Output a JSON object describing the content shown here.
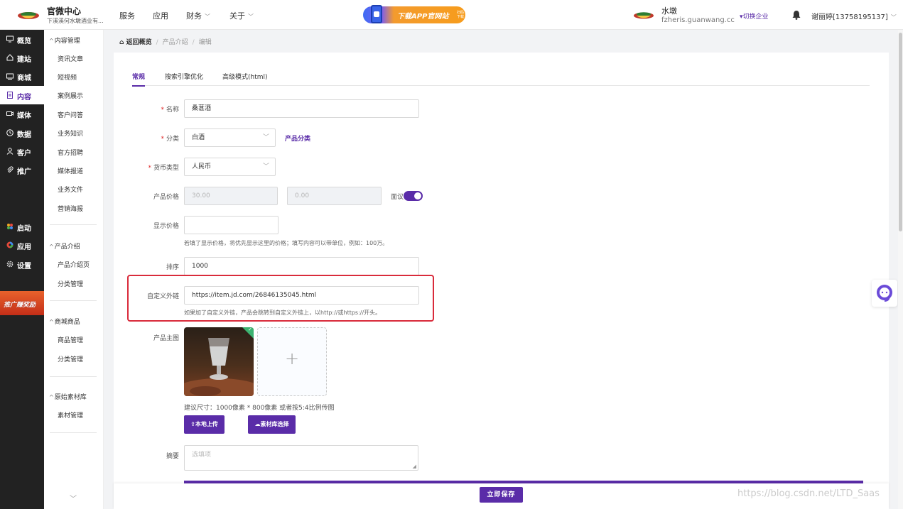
{
  "header": {
    "brand_name": "官微中心",
    "brand_sub": "下溪溪何水墩酒业有...",
    "nav": [
      {
        "label": "服务"
      },
      {
        "label": "应用"
      },
      {
        "label": "财务"
      },
      {
        "label": "关于"
      }
    ],
    "promo_text": "下载APP官网站",
    "promo_scan": "扫码下载",
    "site_name": "水墩",
    "site_domain": "fzheris.guanwang.cc",
    "switch_label": "切换企业",
    "user": "谢丽婷[13758195137]"
  },
  "sidebar_main": {
    "items": [
      {
        "label": "概览",
        "icon": "overview-icon"
      },
      {
        "label": "建站",
        "icon": "home-icon"
      },
      {
        "label": "商城",
        "icon": "shop-icon"
      },
      {
        "label": "内容",
        "icon": "document-icon",
        "active": true
      },
      {
        "label": "媒体",
        "icon": "video-icon"
      },
      {
        "label": "数据",
        "icon": "clock-icon"
      },
      {
        "label": "客户",
        "icon": "user-icon"
      },
      {
        "label": "推广",
        "icon": "paperclip-icon"
      },
      {
        "label": "启动",
        "icon": "flower-icon"
      },
      {
        "label": "应用",
        "icon": "apps-icon"
      },
      {
        "label": "设置",
        "icon": "gear-icon"
      }
    ],
    "reward_label": "推广赚奖励"
  },
  "sidebar_sub": {
    "groups": [
      {
        "title": "内容管理",
        "items": [
          "资讯文章",
          "短视频",
          "案例展示",
          "客户问答",
          "业务知识",
          "官方招聘",
          "媒体报道",
          "业务文件",
          "营销海报"
        ]
      },
      {
        "title": "产品介绍",
        "items": [
          "产品介绍页",
          "分类管理"
        ]
      },
      {
        "title": "商城商品",
        "items": [
          "商品管理",
          "分类管理"
        ]
      },
      {
        "title": "原始素材库",
        "items": [
          "素材管理"
        ]
      }
    ]
  },
  "breadcrumb": {
    "home": "返回概览",
    "level1": "产品介绍",
    "level2": "编辑"
  },
  "tabs": [
    "常规",
    "搜索引擎优化",
    "高级模式(html)"
  ],
  "form": {
    "name": {
      "label": "名称",
      "value": "桑葚酒"
    },
    "category": {
      "label": "分类",
      "value": "白酒",
      "link": "产品分类"
    },
    "currency": {
      "label": "货币类型",
      "value": "人民币"
    },
    "price": {
      "label": "产品价格",
      "value1": "30.00",
      "value2": "0.00",
      "negotiable_label": "面议",
      "negotiable_on": true
    },
    "display_price": {
      "label": "显示价格",
      "value": "",
      "hint": "若填了显示价格，将优先显示这里的价格；填写内容可以带单位，例如：100万。"
    },
    "sort": {
      "label": "排序",
      "value": "1000"
    },
    "custom_link": {
      "label": "自定义外链",
      "value": "https://item.jd.com/26846135045.html",
      "hint": "如果加了自定义外链，产品会跳转到自定义外链上，以http://或https://开头。"
    },
    "main_image": {
      "label": "产品主图",
      "size_hint": "建议尺寸：1000像素 * 800像素 或者按5:4比例传图",
      "upload_label": "本地上传",
      "library_label": "素材库选择"
    },
    "summary": {
      "label": "摘要",
      "placeholder": "选填项"
    }
  },
  "footer": {
    "save_label": "立即保存"
  },
  "watermark": "https://blog.csdn.net/LTD_Saas",
  "colors": {
    "accent": "#5a2ca8",
    "highlight_border": "#d92b3b",
    "sidebar_bg": "#222222"
  }
}
